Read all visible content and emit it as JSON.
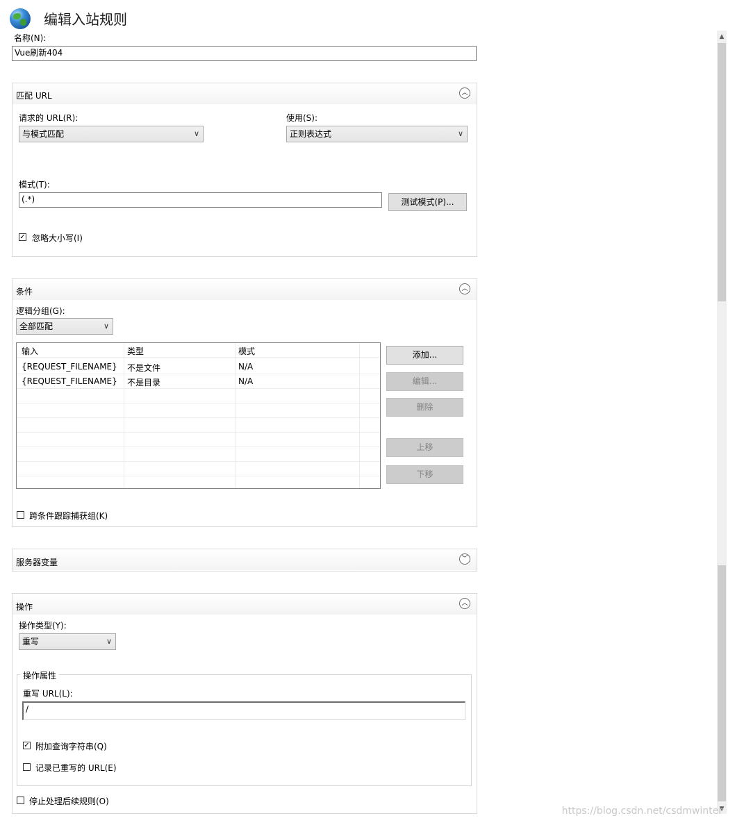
{
  "header": {
    "title": "编辑入站规则",
    "icon": "globe-icon"
  },
  "name": {
    "label": "名称(N):",
    "value": "Vue刷新404"
  },
  "match_url": {
    "title": "匹配 URL",
    "requested_url_label": "请求的 URL(R):",
    "requested_url_value": "与模式匹配",
    "using_label": "使用(S):",
    "using_value": "正则表达式",
    "pattern_label": "模式(T):",
    "pattern_value": "(.*)",
    "test_button": "测试模式(P)...",
    "ignore_case_label": "忽略大小写(I)",
    "ignore_case_checked": true
  },
  "conditions": {
    "title": "条件",
    "logical_group_label": "逻辑分组(G):",
    "logical_group_value": "全部匹配",
    "columns": [
      "输入",
      "类型",
      "模式"
    ],
    "rows": [
      [
        "{REQUEST_FILENAME}",
        "不是文件",
        "N/A"
      ],
      [
        "{REQUEST_FILENAME}",
        "不是目录",
        "N/A"
      ]
    ],
    "buttons": {
      "add": "添加...",
      "edit": "编辑...",
      "delete": "删除",
      "up": "上移",
      "down": "下移"
    },
    "track_groups_label": "跨条件跟踪捕获组(K)",
    "track_groups_checked": false
  },
  "server_vars": {
    "title": "服务器变量"
  },
  "action": {
    "title": "操作",
    "type_label": "操作类型(Y):",
    "type_value": "重写",
    "properties_title": "操作属性",
    "rewrite_url_label": "重写 URL(L):",
    "rewrite_url_value": "/",
    "append_query_label": "附加查询字符串(Q)",
    "append_query_checked": true,
    "log_rewritten_label": "记录已重写的 URL(E)",
    "log_rewritten_checked": false,
    "stop_processing_label": "停止处理后续规则(O)",
    "stop_processing_checked": false
  },
  "watermark": "https://blog.csdn.net/csdmwinter"
}
